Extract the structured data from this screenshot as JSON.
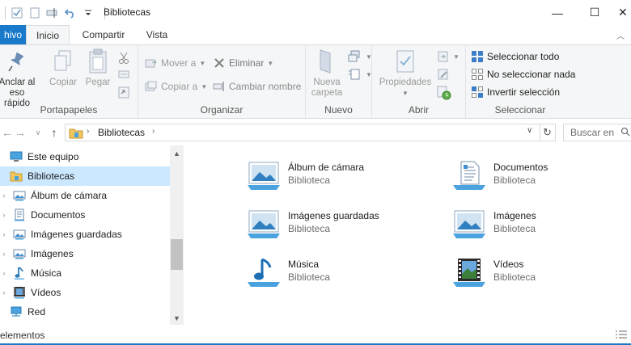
{
  "window": {
    "title": "Bibliotecas",
    "minimize_glyph": "—",
    "maximize_glyph": "☐",
    "close_glyph": "✕"
  },
  "ribbon_tabs": {
    "file": "hivo",
    "home": "Inicio",
    "share": "Compartir",
    "view": "Vista"
  },
  "ribbon": {
    "portapapeles": {
      "label": "Portapapeles",
      "pin_line1": "Anclar al",
      "pin_line2": "eso rápido",
      "copy": "Copiar",
      "paste": "Pegar"
    },
    "organizar": {
      "label": "Organizar",
      "move_to": "Mover a",
      "copy_to": "Copiar a",
      "delete": "Eliminar",
      "rename": "Cambiar nombre"
    },
    "nuevo": {
      "label": "Nuevo",
      "new_folder_line1": "Nueva",
      "new_folder_line2": "carpeta"
    },
    "abrir": {
      "label": "Abrir",
      "properties": "Propiedades"
    },
    "seleccionar": {
      "label": "Seleccionar",
      "select_all": "Seleccionar todo",
      "select_none": "No seleccionar nada",
      "invert": "Invertir selección"
    }
  },
  "address": {
    "path": "Bibliotecas",
    "search_placeholder": "Buscar en"
  },
  "nav_pane": {
    "items": [
      {
        "label": "Este equipo",
        "icon": "computer-icon"
      },
      {
        "label": "Bibliotecas",
        "icon": "libraries-icon",
        "selected": true
      },
      {
        "label": "Álbum de cámara",
        "icon": "pictures-library-icon"
      },
      {
        "label": "Documentos",
        "icon": "documents-library-icon"
      },
      {
        "label": "Imágenes guardadas",
        "icon": "pictures-library-icon"
      },
      {
        "label": "Imágenes",
        "icon": "pictures-library-icon"
      },
      {
        "label": "Música",
        "icon": "music-library-icon"
      },
      {
        "label": "Vídeos",
        "icon": "videos-library-icon"
      },
      {
        "label": "Red",
        "icon": "network-icon"
      }
    ]
  },
  "libraries": [
    {
      "name": "Álbum de cámara",
      "type": "Biblioteca",
      "icon": "pictures-library-icon"
    },
    {
      "name": "Documentos",
      "type": "Biblioteca",
      "icon": "documents-library-icon"
    },
    {
      "name": "Imágenes guardadas",
      "type": "Biblioteca",
      "icon": "pictures-library-icon"
    },
    {
      "name": "Imágenes",
      "type": "Biblioteca",
      "icon": "pictures-library-icon"
    },
    {
      "name": "Música",
      "type": "Biblioteca",
      "icon": "music-library-icon"
    },
    {
      "name": "Vídeos",
      "type": "Biblioteca",
      "icon": "videos-library-icon"
    }
  ],
  "status": {
    "text": "elementos"
  },
  "colors": {
    "accent": "#1979ca",
    "selection": "#cce8ff"
  }
}
